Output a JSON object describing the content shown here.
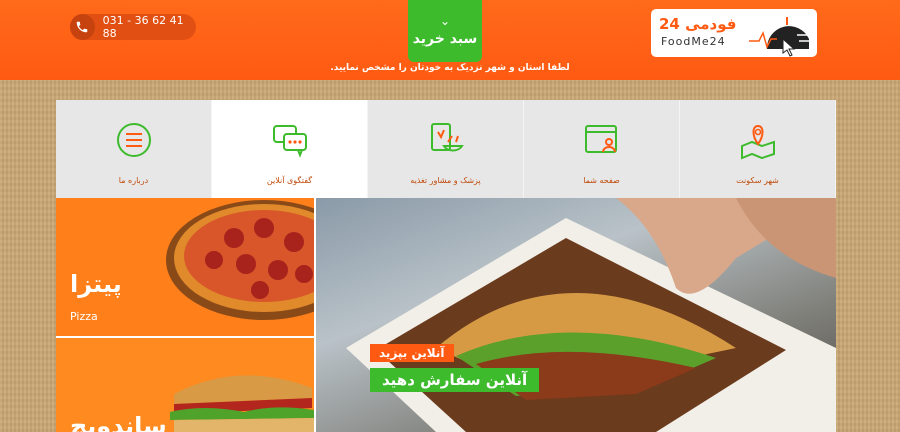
{
  "header": {
    "phone": "031 - 36 62 41 88",
    "cart_label": "سبد خرید",
    "province_notice": "لطفا استان و شهر نزدیک به خودتان را مشخص نمایید.",
    "logo_title": "فودمی 24",
    "logo_sub": "FoodMe24"
  },
  "nav": {
    "items": [
      {
        "label": "درباره ما",
        "icon": "menu-lines-icon"
      },
      {
        "label": "گفتگوی آنلاین",
        "icon": "chat-bubbles-icon"
      },
      {
        "label": "پزشک و مشاور تغذیه",
        "icon": "nutrition-book-icon"
      },
      {
        "label": "صفحه شما",
        "icon": "user-page-icon"
      },
      {
        "label": "شهر سکونت",
        "icon": "map-pin-icon"
      }
    ]
  },
  "tiles": {
    "pizza": {
      "title": "پیتزا",
      "subtitle": "Pizza"
    },
    "sandwich": {
      "title": "ساندویچ"
    }
  },
  "banner": {
    "line1": "آنلاین بپزید",
    "line2": "آنلاین سفارش دهید"
  },
  "colors": {
    "orange": "#ff5a12",
    "green": "#3dbb2d",
    "nav_bg": "#e7e7e7"
  }
}
